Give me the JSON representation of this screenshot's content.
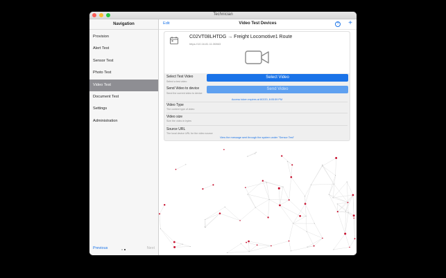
{
  "window": {
    "title": "Technician"
  },
  "sidebar": {
    "header": "Navigation",
    "items": [
      {
        "label": "Provision"
      },
      {
        "label": "Alert Test"
      },
      {
        "label": "Sensor Test"
      },
      {
        "label": "Photo Test"
      },
      {
        "label": "Video Test",
        "selected": true
      },
      {
        "label": "Document Test"
      },
      {
        "label": "Settings"
      },
      {
        "label": "Administration"
      }
    ],
    "footer": {
      "previous": "Previous",
      "next": "Next",
      "page_count": 2,
      "current_page": 2
    }
  },
  "main": {
    "edit_label": "Edit",
    "title": "Video Test Devices",
    "help_icon": "help-circle-icon",
    "add_icon": "plus-icon",
    "device": {
      "route": "C02VT08LHTDG → Freight Locomotive1 Route",
      "url": "https://10.16.81.11:30863"
    },
    "rows": {
      "select_video": {
        "label": "Select Test Video",
        "sub": "Select a test video",
        "button": "Select Video"
      },
      "send_video": {
        "label": "Send Video to device",
        "sub": "Send the current video to device",
        "button": "Send Video"
      },
      "access_note": "Access token expires at 8/2/20, 8:05:59 PM",
      "video_type": {
        "label": "Video Type",
        "sub": "The content type of video"
      },
      "video_size": {
        "label": "Video size",
        "sub": "Size the video in bytes"
      },
      "source_url": {
        "label": "Source URL",
        "sub": "The local device URL for the video source"
      }
    },
    "footer_note": "View the message sent through the system under \"Sensor Test\""
  },
  "colors": {
    "accent": "#1a73e8",
    "selected_row": "#8e8e93",
    "network_red": "#c8102e"
  }
}
